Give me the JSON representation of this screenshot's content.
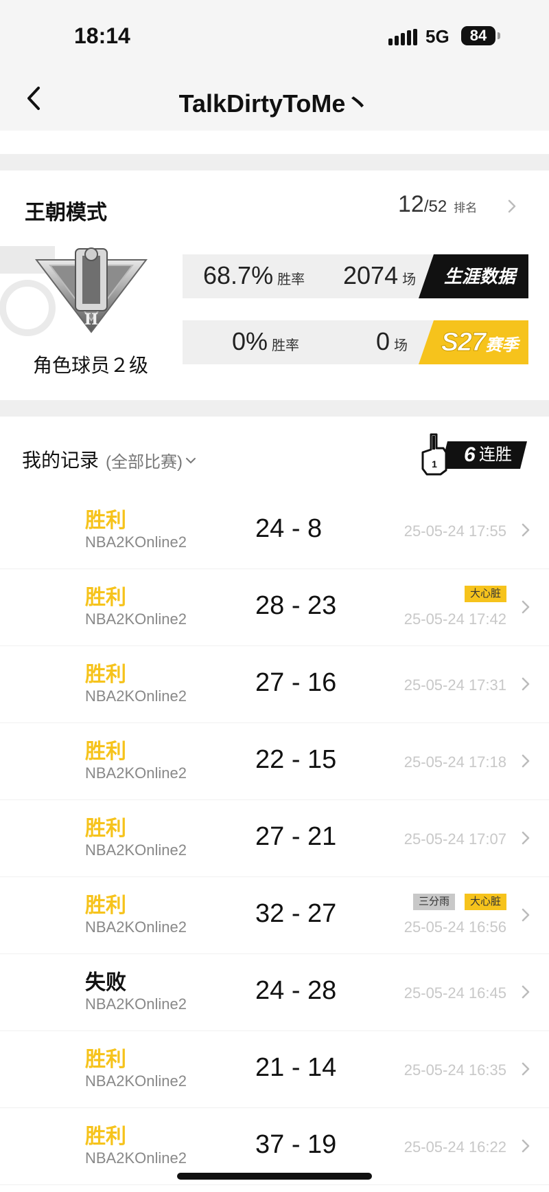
{
  "status_bar": {
    "time": "18:14",
    "network": "5G",
    "battery": "84"
  },
  "nav": {
    "title": "TalkDirtyToMe丶"
  },
  "dynasty": {
    "title": "王朝模式",
    "rank_position": "12",
    "rank_total": "/52",
    "rank_label": "排名",
    "role_label": "角色球员２级",
    "career": {
      "win_rate": "68.7%",
      "win_rate_label": "胜率",
      "games": "2074",
      "games_label": "场",
      "tag": "生涯数据"
    },
    "season": {
      "win_rate": "0%",
      "win_rate_label": "胜率",
      "games": "0",
      "games_label": "场",
      "tag_code": "S27",
      "tag_label": "赛季"
    }
  },
  "records": {
    "title": "我的记录",
    "filter": "(全部比赛)",
    "streak_count": "6",
    "streak_label": "连胜"
  },
  "matches": [
    {
      "result": "胜利",
      "outcome": "win",
      "game": "NBA2KOnline2",
      "score": "24 - 8",
      "time": "25-05-24 17:55",
      "tags": []
    },
    {
      "result": "胜利",
      "outcome": "win",
      "game": "NBA2KOnline2",
      "score": "28 - 23",
      "time": "25-05-24 17:42",
      "tags": [
        {
          "label": "大心脏",
          "color": "#f6c31c"
        }
      ]
    },
    {
      "result": "胜利",
      "outcome": "win",
      "game": "NBA2KOnline2",
      "score": "27 - 16",
      "time": "25-05-24 17:31",
      "tags": []
    },
    {
      "result": "胜利",
      "outcome": "win",
      "game": "NBA2KOnline2",
      "score": "22 - 15",
      "time": "25-05-24 17:18",
      "tags": []
    },
    {
      "result": "胜利",
      "outcome": "win",
      "game": "NBA2KOnline2",
      "score": "27 - 21",
      "time": "25-05-24 17:07",
      "tags": []
    },
    {
      "result": "胜利",
      "outcome": "win",
      "game": "NBA2KOnline2",
      "score": "32 - 27",
      "time": "25-05-24 16:56",
      "tags": [
        {
          "label": "三分雨",
          "color": "#c8c8c8"
        },
        {
          "label": "大心脏",
          "color": "#f6c31c"
        }
      ]
    },
    {
      "result": "失败",
      "outcome": "loss",
      "game": "NBA2KOnline2",
      "score": "24 - 28",
      "time": "25-05-24 16:45",
      "tags": []
    },
    {
      "result": "胜利",
      "outcome": "win",
      "game": "NBA2KOnline2",
      "score": "21 - 14",
      "time": "25-05-24 16:35",
      "tags": []
    },
    {
      "result": "胜利",
      "outcome": "win",
      "game": "NBA2KOnline2",
      "score": "37 - 19",
      "time": "25-05-24 16:22",
      "tags": []
    }
  ],
  "colors": {
    "accent": "#f6c31c",
    "dark": "#111111",
    "muted": "#888888"
  },
  "icons": [
    "back-arrow-icon",
    "chevron-right-icon",
    "chevron-down-icon",
    "foam-finger-icon",
    "rank-emblem-icon"
  ]
}
